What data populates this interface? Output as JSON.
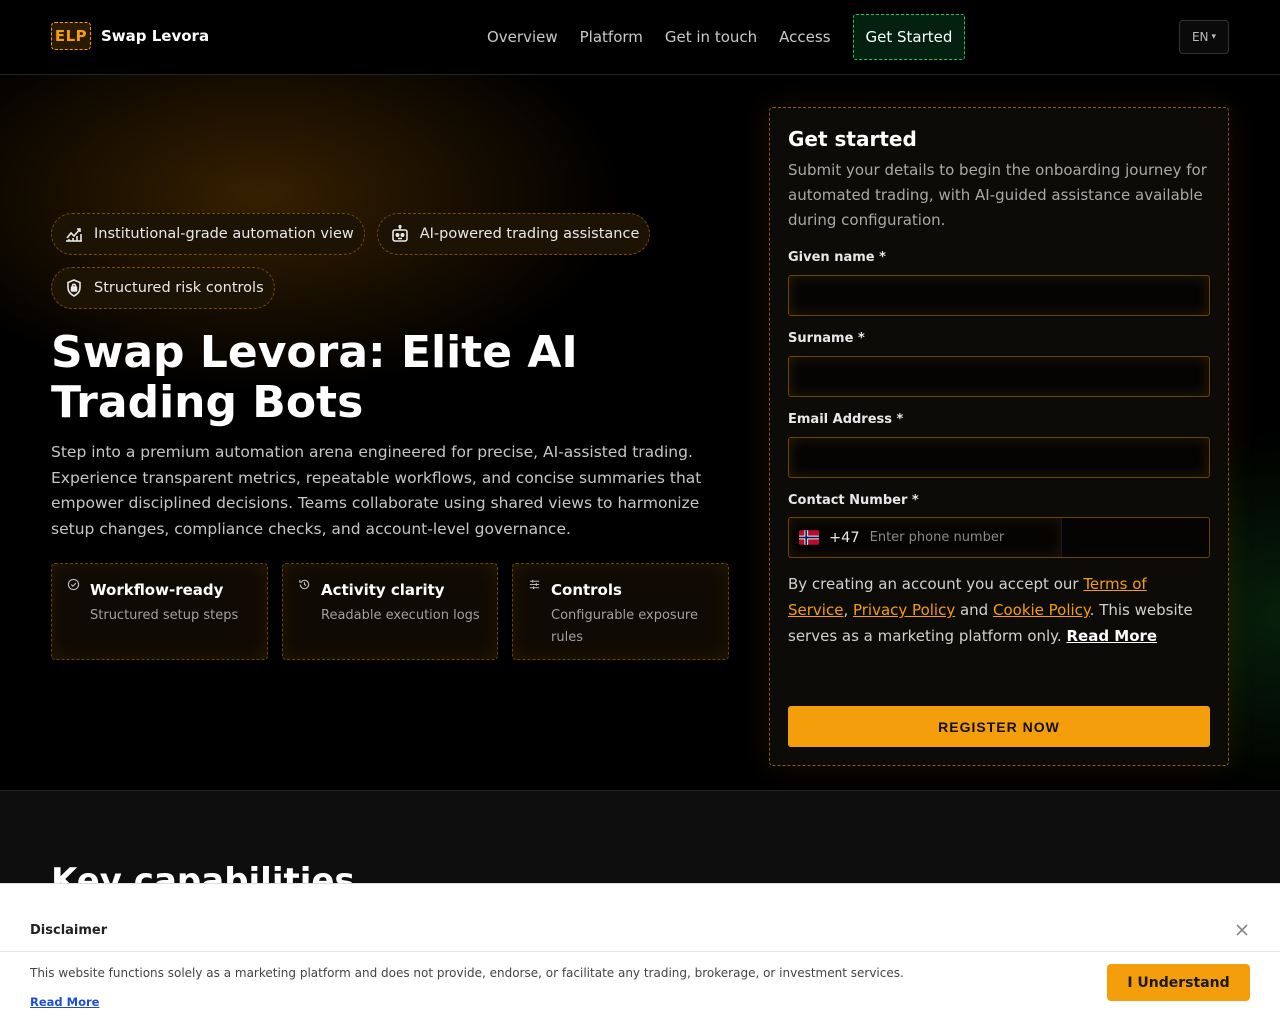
{
  "header": {
    "logo_mark": "ELP",
    "brand": "Swap Levora",
    "nav": [
      "Overview",
      "Platform",
      "Get in touch",
      "Access"
    ],
    "cta": "Get Started",
    "lang": "EN",
    "lang_caret": "▾"
  },
  "hero": {
    "chips": [
      {
        "label": "Institutional-grade automation view",
        "icon": "chart-growth-icon"
      },
      {
        "label": "AI-powered trading assistance",
        "icon": "robot-icon"
      },
      {
        "label": "Structured risk controls",
        "icon": "shield-lock-icon"
      }
    ],
    "title": "Swap Levora: Elite AI Trading Bots",
    "description": "Step into a premium automation arena engineered for precise, AI-assisted trading. Experience transparent metrics, repeatable workflows, and concise summaries that empower disciplined decisions. Teams collaborate using shared views to harmonize setup changes, compliance checks, and account-level governance.",
    "features": [
      {
        "title": "Workflow-ready",
        "subtitle": "Structured setup steps",
        "icon": "check-circle-icon"
      },
      {
        "title": "Activity clarity",
        "subtitle": "Readable execution logs",
        "icon": "history-icon"
      },
      {
        "title": "Controls",
        "subtitle": "Configurable exposure rules",
        "icon": "sliders-icon"
      }
    ]
  },
  "form": {
    "title": "Get started",
    "subtitle": "Submit your details to begin the onboarding journey for automated trading, with AI-guided assistance available during configuration.",
    "given_name_label": "Given name *",
    "surname_label": "Surname *",
    "email_label": "Email Address *",
    "phone_label": "Contact Number *",
    "phone_code": "+47",
    "phone_placeholder": "Enter phone number",
    "terms_prefix": "By creating an account you accept our ",
    "terms_link": "Terms of Service",
    "terms_sep": ", ",
    "privacy_link": "Privacy Policy",
    "terms_and": " and ",
    "cookie_link": "Cookie Policy",
    "terms_suffix": ". This website serves as a marketing platform only. ",
    "read_more": "Read More",
    "register": "REGISTER NOW"
  },
  "section": {
    "title": "Key capabilities"
  },
  "disclaimer": {
    "title": "Disclaimer",
    "text": "This website functions solely as a marketing platform and does not provide, endorse, or facilitate any trading, brokerage, or investment services.",
    "read_more": "Read More",
    "button": "I Understand"
  },
  "colors": {
    "accent": "#f59e0b",
    "cta_border": "#22c55e",
    "link": "#1d4ed8"
  }
}
